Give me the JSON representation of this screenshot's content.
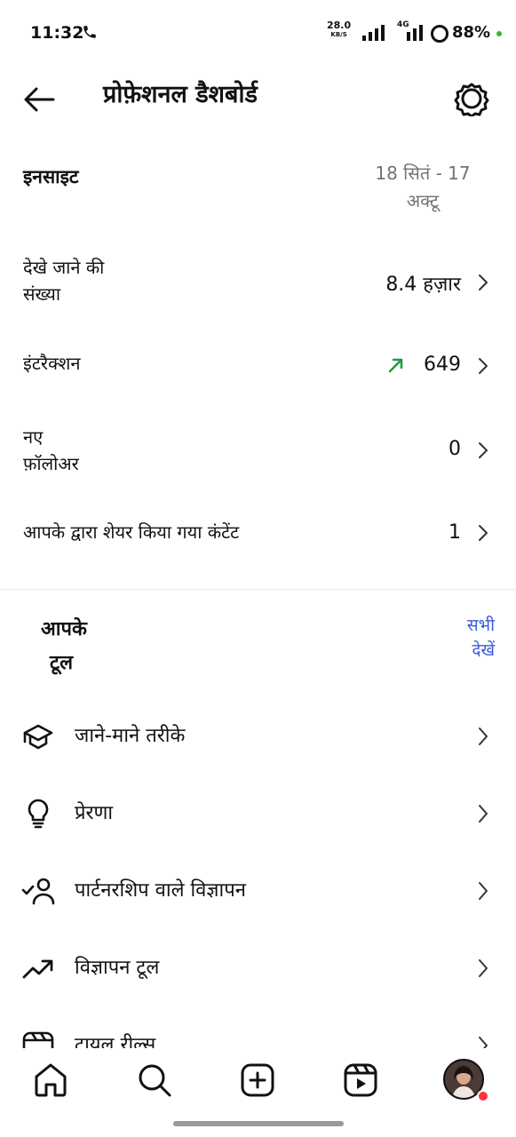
{
  "status_bar": {
    "time": "11:32",
    "net_speed": "28.0",
    "net_unit": "KB/S",
    "network_type": "4G",
    "battery": "88%"
  },
  "header": {
    "title": "प्रोफ़ेशनल डैशबोर्ड",
    "back_icon": "arrow-left-icon",
    "settings_icon": "gear-icon"
  },
  "insights": {
    "title": "इनसाइट",
    "date_range_line1": "18 सितं - 17",
    "date_range_line2": "अक्टू",
    "metrics": [
      {
        "label_line1": "देखे जाने की",
        "label_line2": "संख्या",
        "value": "8.4 हज़ार"
      },
      {
        "label_line1": "इंटरैक्शन",
        "label_line2": "",
        "value": "649",
        "trend": "up"
      },
      {
        "label_line1": "नए",
        "label_line2": "फ़ॉलोअर",
        "value": "0"
      },
      {
        "label_line1": "आपके द्वारा शेयर किया गया कंटेंट",
        "label_line2": "",
        "value": "1"
      }
    ]
  },
  "tools": {
    "title_line1": "आपके",
    "title_line2": "टूल",
    "see_all_line1": "सभी",
    "see_all_line2": "देखें",
    "items": [
      {
        "label": "जाने-माने तरीके",
        "icon": "graduation-cap-icon"
      },
      {
        "label": "प्रेरणा",
        "icon": "lightbulb-icon"
      },
      {
        "label": "पार्टनरशिप वाले विज्ञापन",
        "icon": "partnership-user-icon"
      },
      {
        "label": "विज्ञापन टूल",
        "icon": "trending-up-icon"
      },
      {
        "label": "ट्रायल रील्स",
        "icon": "reels-icon"
      }
    ]
  },
  "bottom_nav": {
    "items": [
      "home-icon",
      "search-icon",
      "create-plus-icon",
      "reels-icon",
      "profile-avatar"
    ]
  },
  "colors": {
    "accent_link": "#3b5bd9",
    "trend_green": "#1a9e3f",
    "muted_text": "#737373",
    "notification_dot": "#ff3040"
  }
}
